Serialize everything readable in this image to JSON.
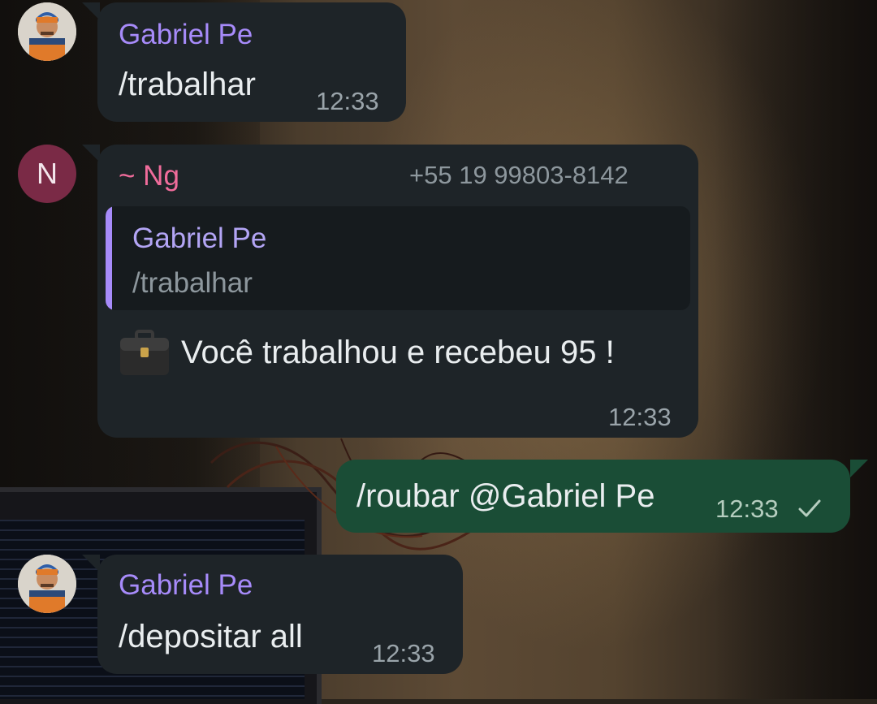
{
  "colors": {
    "incoming_bubble": "#1e2428",
    "outgoing_bubble": "#1a4d36",
    "gabriel_name": "#a78bfa",
    "ng_name": "#f06c9b",
    "message_text": "#e9edef",
    "timestamp": "#9aa4aa"
  },
  "messages": [
    {
      "sender": "Gabriel Pe",
      "text": "/trabalhar",
      "time": "12:33",
      "avatar": "person-photo-avatar"
    },
    {
      "sender": "~ Ng",
      "phone": "+55 19 99803-8142",
      "avatar_letter": "N",
      "quote": {
        "sender": "Gabriel Pe",
        "text": "/trabalhar"
      },
      "icon": "briefcase-icon",
      "text": "Você trabalhou e recebeu 95 !",
      "time": "12:33"
    },
    {
      "outgoing": true,
      "text": "/roubar @Gabriel Pe",
      "time": "12:33",
      "status_icon": "single-check-icon"
    },
    {
      "sender": "Gabriel Pe",
      "text": "/depositar all",
      "time": "12:33",
      "avatar": "person-photo-avatar"
    }
  ]
}
